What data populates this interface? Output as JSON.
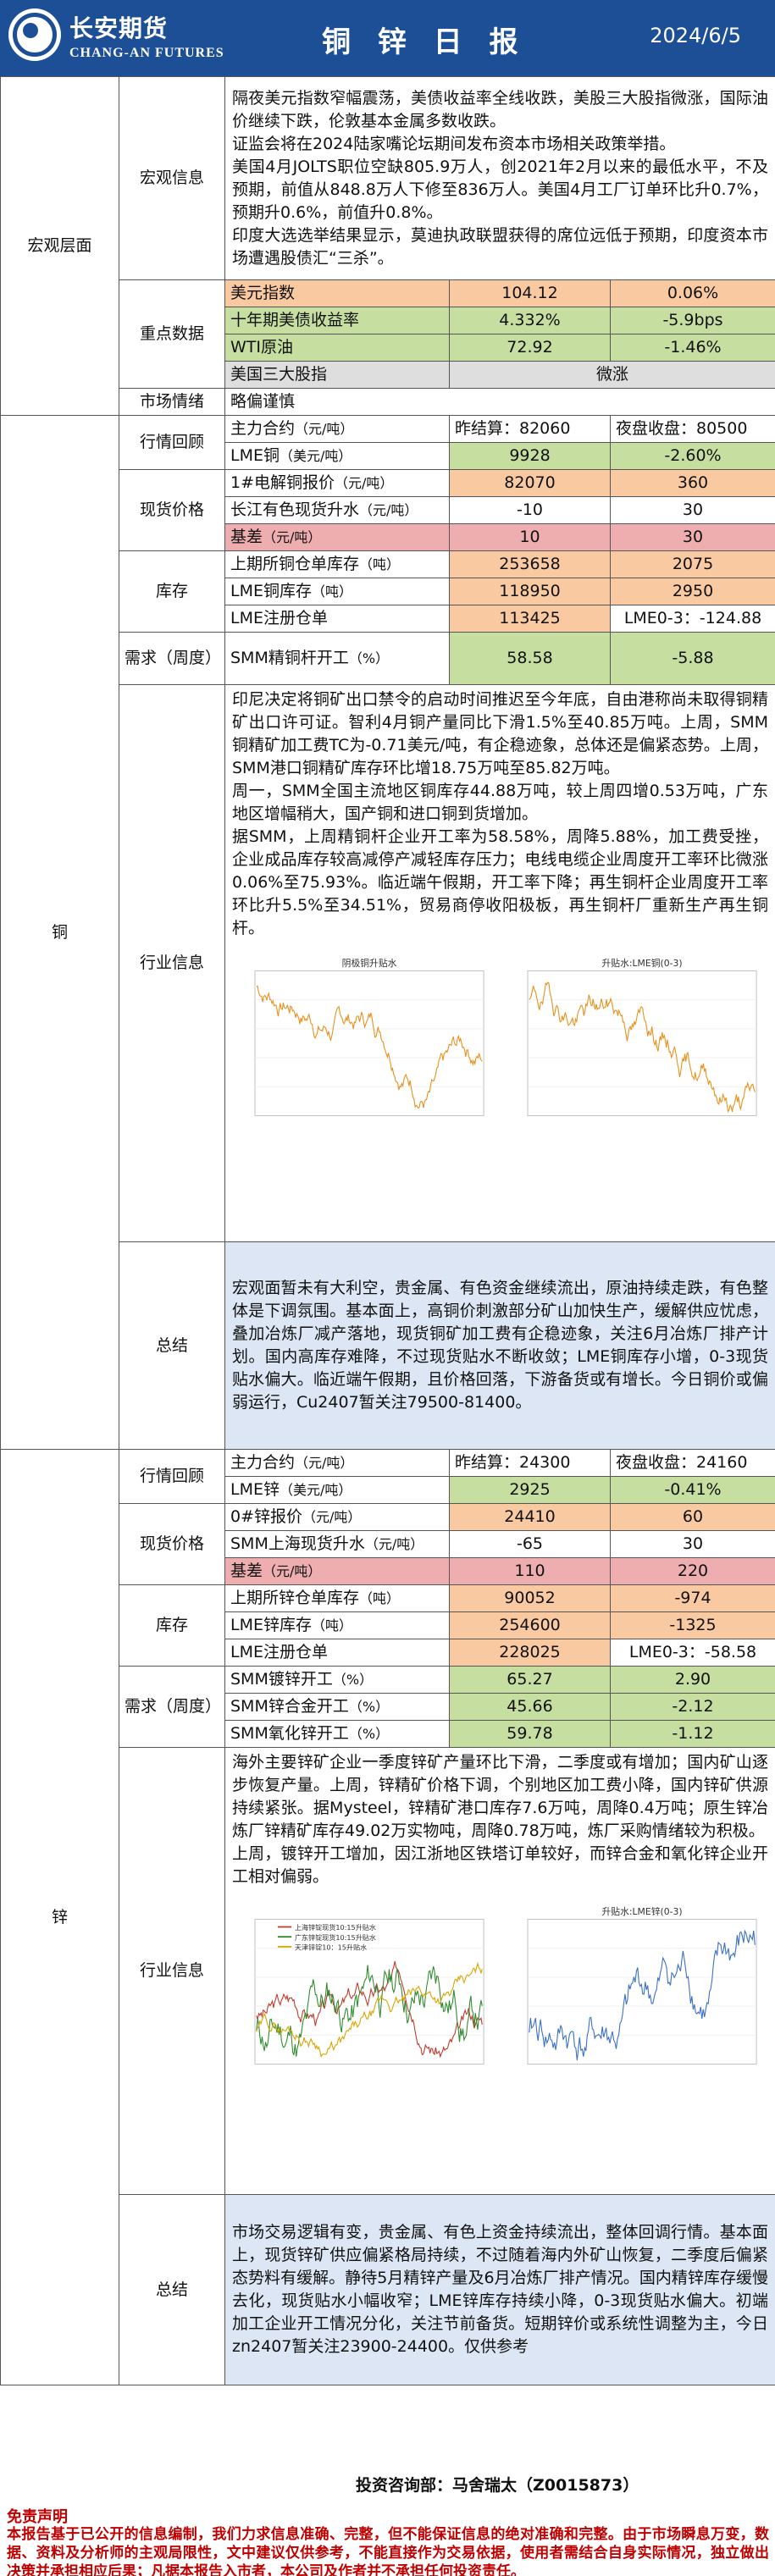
{
  "header": {
    "brand_cn": "长安期货",
    "brand_en": "CHANG-AN FUTURES",
    "title": "铜 锌 日 报",
    "date": "2024/6/5"
  },
  "macro": {
    "section": "宏观层面",
    "info_label": "宏观信息",
    "info_text": "隔夜美元指数窄幅震荡，美债收益率全线收跌，美股三大股指微涨，国际油价继续下跌，伦敦基本金属多数收跌。\n证监会将在2024陆家嘴论坛期间发布资本市场相关政策举措。\n美国4月JOLTS职位空缺805.9万人，创2021年2月以来的最低水平，不及预期，前值从848.8万人下修至836万人。美国4月工厂订单环比升0.7%，预期升0.6%，前值升0.8%。\n印度大选选举结果显示，莫迪执政联盟获得的席位远低于预期，印度资本市场遭遇股债汇“三杀”。",
    "key_label": "重点数据",
    "key_rows": [
      {
        "name": "美元指数",
        "v1": "104.12",
        "v2": "0.06%"
      },
      {
        "name": "十年期美债收益率",
        "v1": "4.332%",
        "v2": "-5.9bps"
      },
      {
        "name": "WTI原油",
        "v1": "72.92",
        "v2": "-1.46%"
      },
      {
        "name": "美国三大股指",
        "v1": "微涨"
      }
    ],
    "sentiment_label": "市场情绪",
    "sentiment": "略偏谨慎"
  },
  "copper": {
    "section": "铜",
    "review_label": "行情回顾",
    "main_name": "主力合约",
    "main_unit": "（元/吨）",
    "main_close": "昨结算：82060",
    "main_night": "夜盘收盘：80500",
    "lme_name": "LME铜",
    "lme_unit": "（美元/吨）",
    "lme_v1": "9928",
    "lme_v2": "-2.60%",
    "spot_label": "现货价格",
    "spot1_name": "1#电解铜报价",
    "spot1_unit": "（元/吨）",
    "spot1_v1": "82070",
    "spot1_v2": "360",
    "spot2_name": "长江有色现货升水",
    "spot2_unit": "（元/吨）",
    "spot2_v1": "-10",
    "spot2_v2": "30",
    "basis_name": "基差",
    "basis_unit": "（元/吨）",
    "basis_v1": "10",
    "basis_v2": "30",
    "stock_label": "库存",
    "stock1_name": "上期所铜仓单库存",
    "stock1_unit": "（吨）",
    "stock1_v1": "253658",
    "stock1_v2": "2075",
    "stock2_name": "LME铜库存",
    "stock2_unit": "（吨）",
    "stock2_v1": "118950",
    "stock2_v2": "2950",
    "stock3_name": "LME注册仓单",
    "stock3_v1": "113425",
    "stock3_v2": "LME0-3：-124.88",
    "demand_label": "需求（周度）",
    "demand1_name": "SMM精铜杆开工",
    "demand1_unit": "（%）",
    "demand1_v1": "58.58",
    "demand1_v2": "-5.88",
    "industry_label": "行业信息",
    "industry_text": "印尼决定将铜矿出口禁令的启动时间推迟至今年底，自由港称尚未取得铜精矿出口许可证。智利4月铜产量同比下滑1.5%至40.85万吨。上周，SMM铜精矿加工费TC为-0.71美元/吨，有企稳迹象，总体还是偏紧态势。上周，SMM港口铜精矿库存环比增18.75万吨至85.82万吨。\n周一，SMM全国主流地区铜库存44.88万吨，较上周四增0.53万吨，广东地区增幅稍大，国产铜和进口铜到货增加。\n据SMM，上周精铜杆企业开工率为58.58%，周降5.88%，加工费受挫，企业成品库存较高减停产减轻库存压力；电线电缆企业周度开工率环比微涨0.06%至75.93%。临近端午假期，开工率下降；再生铜杆企业周度开工率环比升5.5%至34.51%，贸易商停收阳极板，再生铜杆厂重新生产再生铜杆。",
    "chart1_title": "阴极铜升贴水",
    "chart2_title": "升贴水:LME铜(0-3)",
    "summary_label": "总结",
    "summary_text": "宏观面暂未有大利空，贵金属、有色资金继续流出，原油持续走跌，有色整体是下调氛围。基本面上，高铜价刺激部分矿山加快生产，缓解供应忧虑，叠加冶炼厂减产落地，现货铜矿加工费有企稳迹象，关注6月冶炼厂排产计划。国内高库存难降，不过现货贴水不断收敛；LME铜库存小增，0-3现货贴水偏大。临近端午假期，且价格回落，下游备货或有增长。今日铜价或偏弱运行，Cu2407暂关注79500-81400。"
  },
  "zinc": {
    "section": "锌",
    "review_label": "行情回顾",
    "main_name": "主力合约",
    "main_unit": "（元/吨）",
    "main_close": "昨结算：24300",
    "main_night": "夜盘收盘：24160",
    "lme_name": "LME锌",
    "lme_unit": "（美元/吨）",
    "lme_v1": "2925",
    "lme_v2": "-0.41%",
    "spot_label": "现货价格",
    "spot1_name": "0#锌报价",
    "spot1_unit": "（元/吨）",
    "spot1_v1": "24410",
    "spot1_v2": "60",
    "spot2_name": "SMM上海现货升水",
    "spot2_unit": "（元/吨）",
    "spot2_v1": "-65",
    "spot2_v2": "30",
    "basis_name": "基差",
    "basis_unit": "（元/吨）",
    "basis_v1": "110",
    "basis_v2": "220",
    "stock_label": "库存",
    "stock1_name": "上期所锌仓单库存",
    "stock1_unit": "（吨）",
    "stock1_v1": "90052",
    "stock1_v2": "-974",
    "stock2_name": "LME锌库存",
    "stock2_unit": "（吨）",
    "stock2_v1": "254600",
    "stock2_v2": "-1325",
    "stock3_name": "LME注册仓单",
    "stock3_v1": "228025",
    "stock3_v2": "LME0-3：-58.58",
    "demand_label": "需求（周度）",
    "demand1_name": "SMM镀锌开工",
    "demand1_unit": "（%）",
    "demand1_v1": "65.27",
    "demand1_v2": "2.90",
    "demand2_name": "SMM锌合金开工",
    "demand2_unit": "（%）",
    "demand2_v1": "45.66",
    "demand2_v2": "-2.12",
    "demand3_name": "SMM氧化锌开工",
    "demand3_unit": "（%）",
    "demand3_v1": "59.78",
    "demand3_v2": "-1.12",
    "industry_label": "行业信息",
    "industry_text": "海外主要锌矿企业一季度锌矿产量环比下滑，二季度或有增加；国内矿山逐步恢复产量。上周，锌精矿价格下调，个别地区加工费小降，国内锌矿供源持续紧张。据Mysteel，锌精矿港口库存7.6万吨，周降0.4万吨；原生锌冶炼厂锌精矿库存49.02万实物吨，周降0.78万吨，炼厂采购情绪较为积极。\n上周，镀锌开工增加，因江浙地区铁塔订单较好，而锌合金和氧化锌企业开工相对偏弱。",
    "chart1_legend": [
      "上海锌锭现货10:15升贴水",
      "广东锌锭现货10:15升贴水",
      "天津锌锭10：15升贴水"
    ],
    "chart2_title": "升贴水:LME锌(0-3)",
    "summary_label": "总结",
    "summary_text": "市场交易逻辑有变，贵金属、有色上资金持续流出，整体回调行情。基本面上，现货锌矿供应偏紧格局持续，不过随着海内外矿山恢复，二季度后偏紧态势料有缓解。静待5月精锌产量及6月冶炼厂排产情况。国内精锌库存缓慢去化，现货贴水小幅收窄；LME锌库存持续小降，0-3现货贴水偏大。初端加工企业开工情况分化，关注节前备货。短期锌价或系统性调整为主，今日zn2407暂关注23900-24400。仅供参考"
  },
  "footer": {
    "contact": "投资咨询部：马舍瑞太（Z0015873）",
    "disclaimer_title": "免责声明",
    "disclaimer": "本报告基于已公开的信息编制，我们力求信息准确、完整，但不能保证信息的绝对准确和完整。由于市场瞬息万变，数据、资料及分析师的主观局限性，文中建议仅供参考，不能直接作为交易依据，使用者需结合自身实际情况，独立做出决策并承担相应后果；凡据本报告入市者，本公司及作者并不承担任何投资责任。"
  }
}
